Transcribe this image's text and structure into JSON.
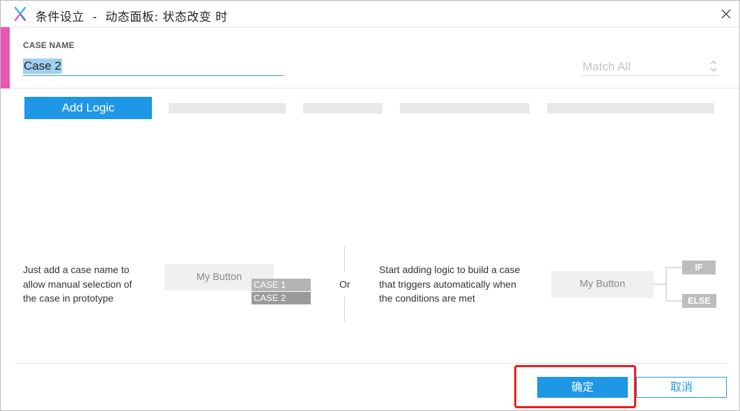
{
  "window": {
    "title": "条件设立  -  动态面板: 状态改变 时",
    "logo_icon": "app-x-logo-icon",
    "close_icon": "close-icon"
  },
  "case": {
    "label": "CASE NAME",
    "value": "Case 2",
    "accent_color": "#e857b6",
    "match_mode": "Match All"
  },
  "toolbar": {
    "add_logic_label": "Add Logic"
  },
  "help": {
    "manual": {
      "text_lines": [
        "Just add a case name to",
        "allow manual selection of",
        "the case in prototype"
      ],
      "demo_button": "My Button",
      "case_options": [
        "CASE 1",
        "CASE 2"
      ]
    },
    "separator": "Or",
    "auto": {
      "text_lines": [
        "Start adding logic to build a case",
        "that triggers automatically when",
        "the conditions are met"
      ],
      "demo_button": "My Button",
      "branches": [
        "IF",
        "ELSE"
      ]
    }
  },
  "footer": {
    "ok_label": "确定",
    "cancel_label": "取消",
    "primary_color": "#1d97e6"
  }
}
